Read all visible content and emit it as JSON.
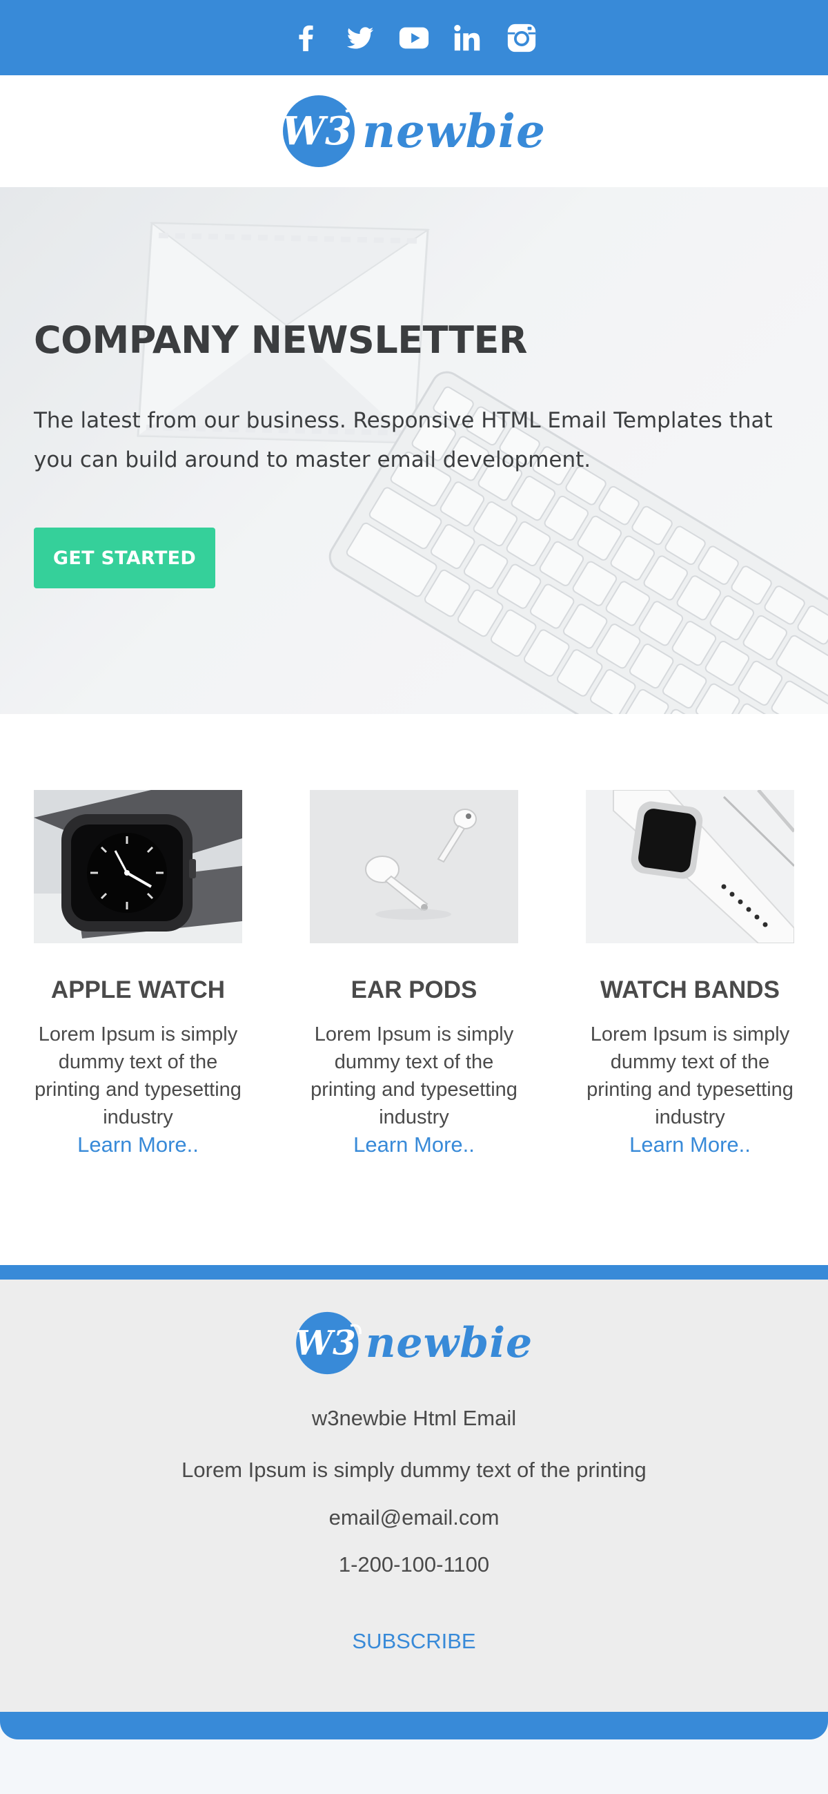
{
  "social": {
    "icons": [
      "facebook-icon",
      "twitter-icon",
      "youtube-icon",
      "linkedin-icon",
      "instagram-icon"
    ],
    "bar_color": "#388ad8"
  },
  "brand": {
    "logo_mark": "W3",
    "logo_text": "newbie",
    "color": "#388ad8"
  },
  "hero": {
    "title": "COMPANY NEWSLETTER",
    "subtitle": "The latest from our business. Responsive HTML Email Templates that you can build around to master email development.",
    "button_label": "GET STARTED",
    "button_color": "#35d09a"
  },
  "products": [
    {
      "title": "APPLE WATCH",
      "description": "Lorem Ipsum is simply dummy text of the printing and typesetting industry",
      "link": "Learn More..",
      "image": "black-apple-watch"
    },
    {
      "title": "EAR PODS",
      "description": "Lorem Ipsum is simply dummy text of the printing and typesetting industry",
      "link": "Learn More..",
      "image": "white-ear-pods"
    },
    {
      "title": "WATCH BANDS",
      "description": "Lorem Ipsum is simply dummy text of the printing and typesetting industry",
      "link": "Learn More..",
      "image": "white-watch-band"
    }
  ],
  "footer": {
    "company": "w3newbie Html Email",
    "tagline": "Lorem Ipsum is simply dummy text of the printing",
    "email": "email@email.com",
    "phone": "1-200-100-1100",
    "subscribe": "SUBSCRIBE",
    "background": "#ededed"
  }
}
